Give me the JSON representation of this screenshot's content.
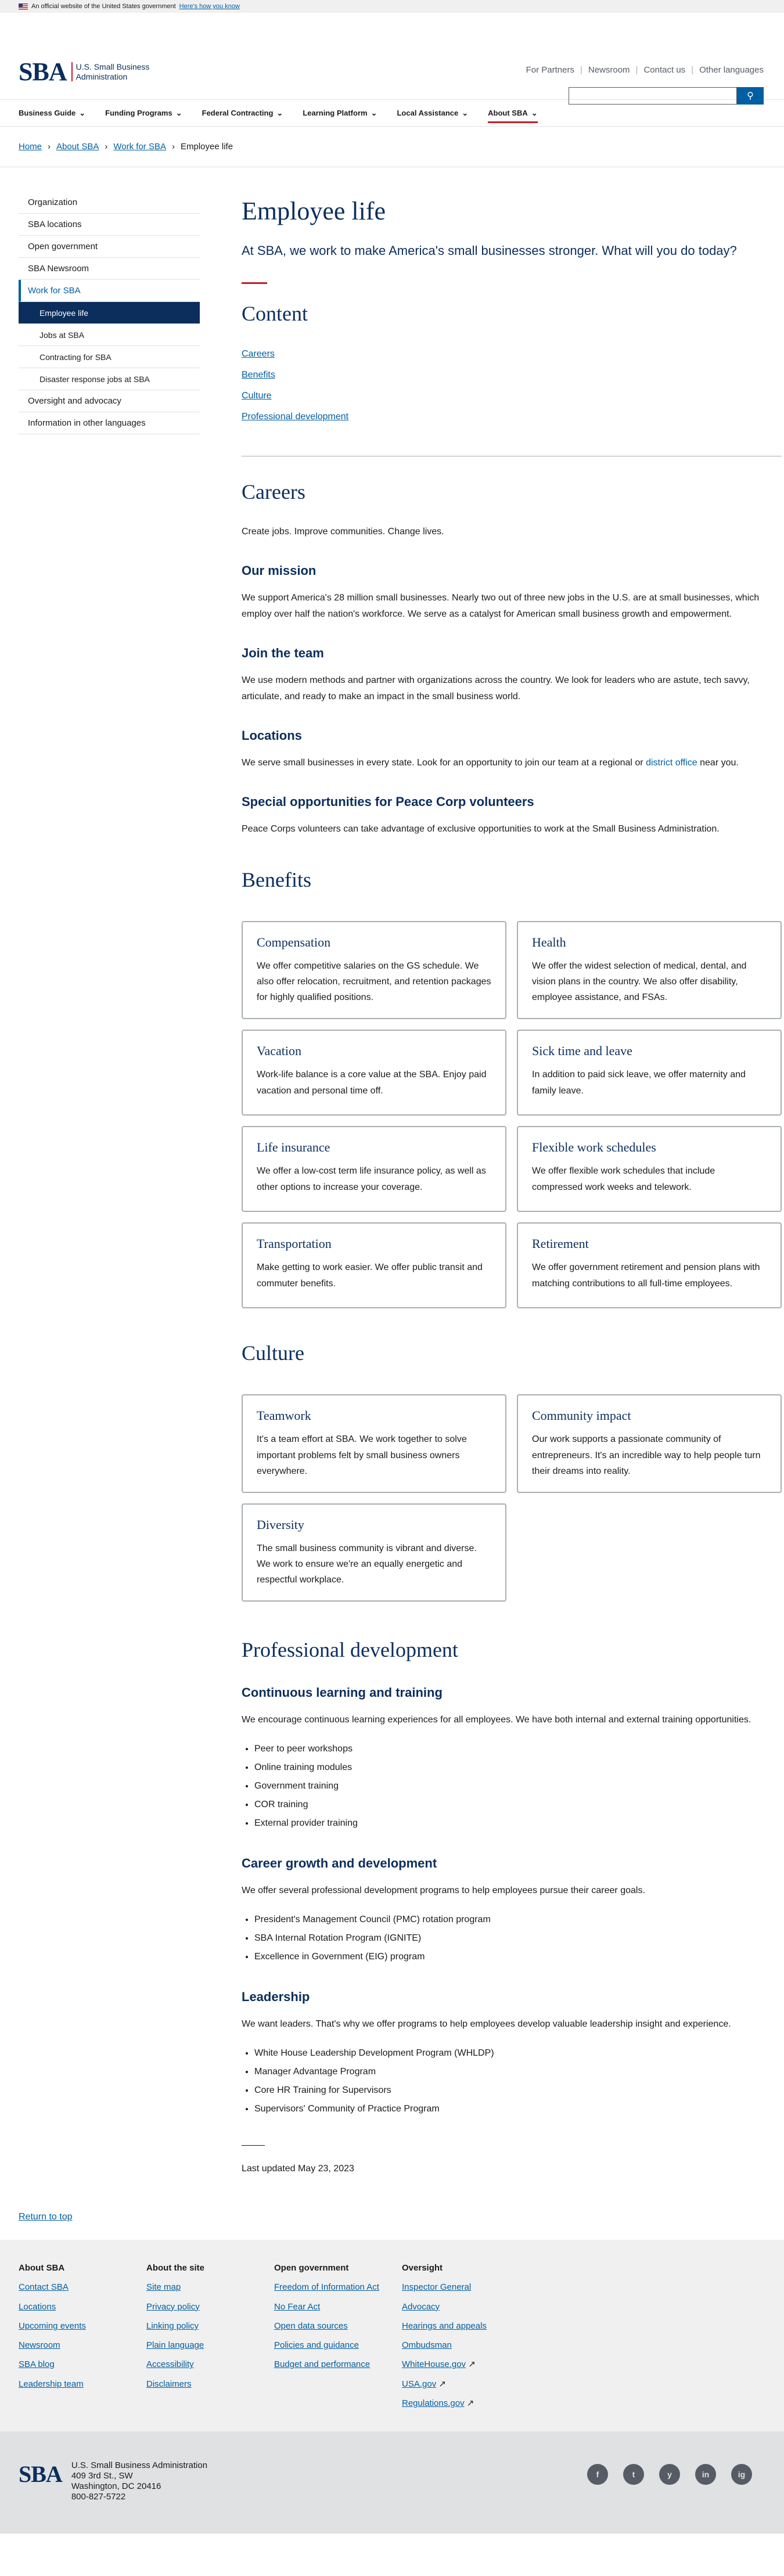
{
  "gov_banner": {
    "text": "An official website of the United States government",
    "how": "Here's how you know"
  },
  "logo": {
    "mark": "SBA",
    "text": "U.S. Small Business Administration"
  },
  "utility": [
    "For Partners",
    "Newsroom",
    "Contact us",
    "Other languages"
  ],
  "search": {
    "placeholder": ""
  },
  "nav": [
    {
      "label": "Business Guide"
    },
    {
      "label": "Funding Programs"
    },
    {
      "label": "Federal Contracting"
    },
    {
      "label": "Learning Platform"
    },
    {
      "label": "Local Assistance"
    },
    {
      "label": "About SBA"
    }
  ],
  "breadcrumb": [
    "Home",
    "About SBA",
    "Work for SBA",
    "Employee life"
  ],
  "sidebar": {
    "items": [
      "Organization",
      "SBA locations",
      "Open government",
      "SBA Newsroom",
      "Work for SBA"
    ],
    "sub": [
      "Employee life",
      "Jobs at SBA",
      "Contracting for SBA",
      "Disaster response jobs at SBA"
    ],
    "after": [
      "Oversight and advocacy",
      "Information in other languages"
    ]
  },
  "page": {
    "title": "Employee life",
    "intro": "At SBA, we work to make America's small businesses stronger. What will you do today?",
    "content_heading": "Content",
    "toc": [
      "Careers",
      "Benefits",
      "Culture",
      "Professional development"
    ]
  },
  "careers": {
    "heading": "Careers",
    "lead": "Create jobs. Improve communities. Change lives.",
    "mission_h": "Our mission",
    "mission": "We support America's 28 million small businesses. Nearly two out of three new jobs in the U.S. are at small businesses, which employ over half the nation's workforce. We serve as a catalyst for American small business growth and empowerment.",
    "team_h": "Join the team",
    "team": "We use modern methods and partner with organizations across the country. We look for leaders who are astute, tech savvy, articulate, and ready to make an impact in the small business world.",
    "loc_h": "Locations",
    "loc_pre": "We serve small businesses in every state. Look for an opportunity to join our team at a regional or ",
    "loc_link": "district office",
    "loc_post": " near you.",
    "peace_h": "Special opportunities for Peace Corp volunteers",
    "peace": "Peace Corps volunteers can take advantage of exclusive opportunities to work at the Small Business Administration."
  },
  "benefits": {
    "heading": "Benefits",
    "cards": [
      {
        "title": "Compensation",
        "text": "We offer competitive salaries on the GS schedule. We also offer relocation, recruitment, and retention packages for highly qualified positions."
      },
      {
        "title": "Health",
        "text": "We offer the widest selection of medical, dental, and vision plans in the country. We also offer disability, employee assistance, and FSAs."
      },
      {
        "title": "Vacation",
        "text": "Work-life balance is a core value at the SBA. Enjoy paid vacation and personal time off."
      },
      {
        "title": "Sick time and leave",
        "text": "In addition to paid sick leave, we offer maternity and family leave."
      },
      {
        "title": "Life insurance",
        "text": "We offer a low-cost term life insurance policy, as well as other options to increase your coverage."
      },
      {
        "title": "Flexible work schedules",
        "text": "We offer flexible work schedules that include compressed work weeks and telework."
      },
      {
        "title": "Transportation",
        "text": "Make getting to work easier. We offer public transit and commuter benefits."
      },
      {
        "title": "Retirement",
        "text": "We offer government retirement and pension plans with matching contributions to all full-time employees."
      }
    ]
  },
  "culture": {
    "heading": "Culture",
    "cards": [
      {
        "title": "Teamwork",
        "text": "It's a team effort at SBA. We work together to solve important problems felt by small business owners everywhere."
      },
      {
        "title": "Community impact",
        "text": "Our work supports a passionate community of entrepreneurs. It's an incredible way to help people turn their dreams into reality."
      },
      {
        "title": "Diversity",
        "text": "The small business community is vibrant and diverse. We work to ensure we're an equally energetic and respectful workplace."
      }
    ]
  },
  "prodev": {
    "heading": "Professional development",
    "cl_h": "Continuous learning and training",
    "cl": "We encourage continuous learning experiences for all employees. We have both internal and external training opportunities.",
    "cl_list": [
      "Peer to peer workshops",
      "Online training modules",
      "Government training",
      "COR training",
      "External provider training"
    ],
    "cg_h": "Career growth and development",
    "cg": "We offer several professional development programs to help employees pursue their career goals.",
    "cg_list": [
      "President's Management Council (PMC) rotation program",
      "SBA Internal Rotation Program (IGNITE)",
      "Excellence in Government (EIG) program"
    ],
    "ld_h": "Leadership",
    "ld": "We want leaders. That's why we offer programs to help employees develop valuable leadership insight and experience.",
    "ld_list": [
      "White House Leadership Development Program (WHLDP)",
      "Manager Advantage Program",
      "Core HR Training for Supervisors",
      "Supervisors' Community of Practice Program"
    ],
    "updated": "Last updated May 23, 2023"
  },
  "return_top": "Return to top",
  "footer": {
    "cols": [
      {
        "title": "About SBA",
        "links": [
          "Contact SBA",
          "Locations",
          "Upcoming events",
          "Newsroom",
          "SBA blog",
          "Leadership team"
        ]
      },
      {
        "title": "About the site",
        "links": [
          "Site map",
          "Privacy policy",
          "Linking policy",
          "Plain language",
          "Accessibility",
          "Disclaimers"
        ]
      },
      {
        "title": "Open government",
        "links": [
          "Freedom of Information Act",
          "No Fear Act",
          "Open data sources",
          "Policies and guidance",
          "Budget and performance"
        ]
      },
      {
        "title": "Oversight",
        "links": [
          "Inspector General",
          "Advocacy",
          "Hearings and appeals",
          "Ombudsman",
          "WhiteHouse.gov",
          "USA.gov",
          "Regulations.gov"
        ]
      }
    ],
    "agency": "U.S. Small Business Administration",
    "addr1": "409 3rd St., SW",
    "addr2": "Washington, DC 20416",
    "phone": "800-827-5722",
    "social": [
      "f",
      "t",
      "y",
      "in",
      "ig"
    ]
  }
}
